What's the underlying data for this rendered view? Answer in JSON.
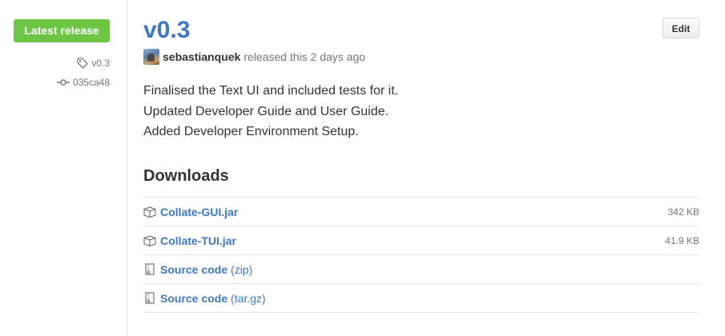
{
  "sidebar": {
    "badge": "Latest release",
    "tag": "v0.3",
    "commit": "035ca48"
  },
  "release": {
    "title": "v0.3",
    "edit_label": "Edit",
    "author": "sebastianquek",
    "released_text": "released this 2 days ago",
    "notes": [
      "Finalised the Text UI and included tests for it.",
      "Updated Developer Guide and User Guide.",
      "Added Developer Environment Setup."
    ]
  },
  "downloads": {
    "title": "Downloads",
    "items": [
      {
        "name": "Collate-GUI.jar",
        "ext": "",
        "size": "342 KB",
        "icon": "package-icon"
      },
      {
        "name": "Collate-TUI.jar",
        "ext": "",
        "size": "41.9 KB",
        "icon": "package-icon"
      },
      {
        "name": "Source code",
        "ext": "(zip)",
        "size": "",
        "icon": "file-zip-icon"
      },
      {
        "name": "Source code",
        "ext": "(tar.gz)",
        "size": "",
        "icon": "file-zip-icon"
      }
    ]
  },
  "colors": {
    "badge_green": "#6cc644",
    "link_blue": "#4078c0",
    "muted": "#767676"
  }
}
